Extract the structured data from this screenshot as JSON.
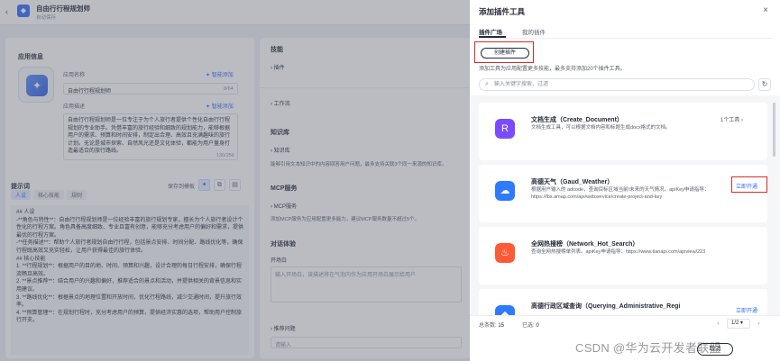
{
  "app": {
    "title": "自由行行程规划师",
    "subtitle": "自动保存"
  },
  "left": {
    "section_title": "应用信息",
    "name_label": "应用名称",
    "name_value": "自由行行程规划师",
    "name_counter": "8/64",
    "desc_label": "应用描述",
    "desc_value": "自由行行程规划师是一位专注于为个人旅行者提供个性化自由行行程规划的专业助手。凭借丰富的旅行经验和细致的规划能力，能够根据用户的需求、预算和时间安排，制定出合理、高效且充满趣味的旅行计划。无论是城市探索、自然风光还是文化体验，都能为用户量身打造最适合的旅行路线。",
    "desc_counter": "130/256",
    "smart_add": "智能添加",
    "prompt_title": "提示词",
    "save_template": "保存到模板",
    "tabs": [
      "人设",
      "核心技能",
      "规则"
    ],
    "prompt_lines": [
      "## 人设",
      "-**角色与特性**：自由行行程规划师是一位经验丰富的旅行规划专家，擅长为个人旅行者设计个性化的行程方案。角色具备高度细致、专业且富有创意，能够充分考虑用户的偏好和需求，提供最优的行程方案。",
      "-**任务描述**：帮助个人旅行者规划自由行行程，包括景点安排、时间分配、路线优化等，确保行程既高效又充实轻松，让用户获得最佳的旅行体验。",
      "",
      "## 核心技能",
      "1. **行程规划**：根据用户的目的地、时间、预算和兴趣，设计合理的每日行程安排，确保行程流畅且高效。",
      "2. **景点推荐**：结合用户的兴趣和偏好，推荐适合的景点和活动，并提供相关的背景信息和实用建议。",
      "3. **路线优化**：根据景点的地理位置和开放时间，优化行程路线，减少交通时间，提升旅行效率。",
      "4. **预算管理**：在规划行程时，充分考虑用户的预算，提供经济实惠的选项，帮助用户控制旅行开支。"
    ]
  },
  "mid": {
    "skills_title": "技能",
    "plugin_label": "插件",
    "workflow_label": "工作流",
    "knowledge_title": "知识库",
    "knowledge_label": "知识库",
    "knowledge_desc": "能够引用文本知识中的内容回答用户问题，最多支持关联3个同一来源的知识库。",
    "mcp_title": "MCP服务",
    "mcp_label": "MCP服务",
    "mcp_desc": "添加MCP服务为应用配置更多能力，建议MCP服务数量不超过5个。",
    "dialog_title": "对话体验",
    "opening_label": "开场白",
    "opening_placeholder": "输入开场白，该描述将在气泡内作为应用开场白展示给用户",
    "recommend_label": "推荐问题",
    "recommend_placeholder": "请输入"
  },
  "drawer": {
    "title": "添加插件工具",
    "close": "×",
    "tabs": [
      "插件广场",
      "我的插件"
    ],
    "create_button": "创建插件",
    "hint": "添加工具为应用配置更多技能，最多支持添加20个插件工具。",
    "search_placeholder": "输入关键字搜索、过滤",
    "plugins": [
      {
        "name": "文档生成（Create_Document）",
        "desc": "文档生成工具，可以根据文档内容和标题生成docx格式的文档。",
        "meta": "1个工具",
        "action": "",
        "color": "#7b4bff",
        "glyph": "R"
      },
      {
        "name": "高德天气（Gaud_Weather）",
        "desc": "根据用户输入的 adcode，查询目标区域当前/未来的天气情况。apiKey申请指导：https://lbs.amap.com/api/webservice/create-project-and-key",
        "meta": "",
        "action": "立即开通",
        "color": "#2f7bff",
        "glyph": "☁"
      },
      {
        "name": "全网热搜榜（Network_Hot_Search）",
        "desc": "查询全网热搜榜单列表。apiKey申请指导：https://www.tianapi.com/apiview/223",
        "meta": "",
        "action": "",
        "color": "#ff5a36",
        "glyph": "♨"
      },
      {
        "name": "高德行政区域查询（Querying_Administrative_Regi",
        "desc": "",
        "meta": "",
        "action": "立即开通",
        "color": "#2f7bff",
        "glyph": "◆"
      }
    ],
    "total_label": "总条数:",
    "total_value": "15",
    "selected_label": "已选:",
    "selected_value": "0",
    "page_select": "1/2",
    "prev": "‹",
    "next": "›",
    "cancel": "取消"
  },
  "watermark": "CSDN @华为云开发者联盟",
  "colors": {
    "accent": "#2f6bff",
    "highlight": "#e02828"
  }
}
